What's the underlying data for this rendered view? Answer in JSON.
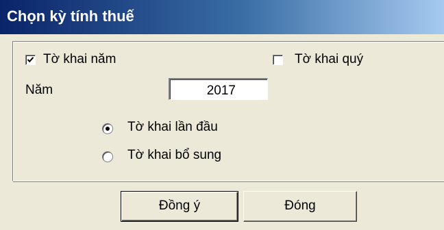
{
  "window": {
    "title": "Chọn kỳ tính thuế"
  },
  "declaration_type": {
    "annual_label": "Tờ khai năm",
    "annual_checked": true,
    "quarterly_label": "Tờ khai quý",
    "quarterly_checked": false
  },
  "year": {
    "label": "Năm",
    "value": "2017"
  },
  "submission": {
    "options": [
      {
        "label": "Tờ khai lần đầu",
        "selected": true
      },
      {
        "label": "Tờ khai bổ sung",
        "selected": false
      }
    ]
  },
  "buttons": {
    "ok_label": "Đồng ý",
    "close_label": "Đóng"
  }
}
